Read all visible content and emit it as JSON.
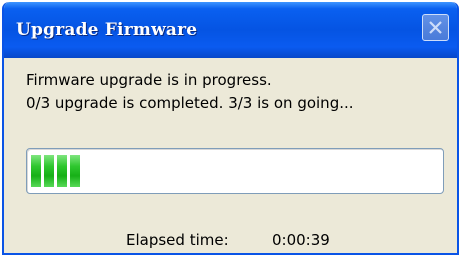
{
  "window": {
    "title": "Upgrade Firmware",
    "close_icon": "close-icon"
  },
  "content": {
    "message_line1": "Firmware upgrade is in progress.",
    "message_line2": "0/3 upgrade is completed. 3/3 is on going..."
  },
  "progress": {
    "percent": 14,
    "color": "#22bb22"
  },
  "elapsed": {
    "label": "Elapsed time:",
    "value": "0:00:39"
  },
  "colors": {
    "titlebar": "#0554e3",
    "body": "#ece9d8",
    "progress_fill": "#22bb22"
  }
}
